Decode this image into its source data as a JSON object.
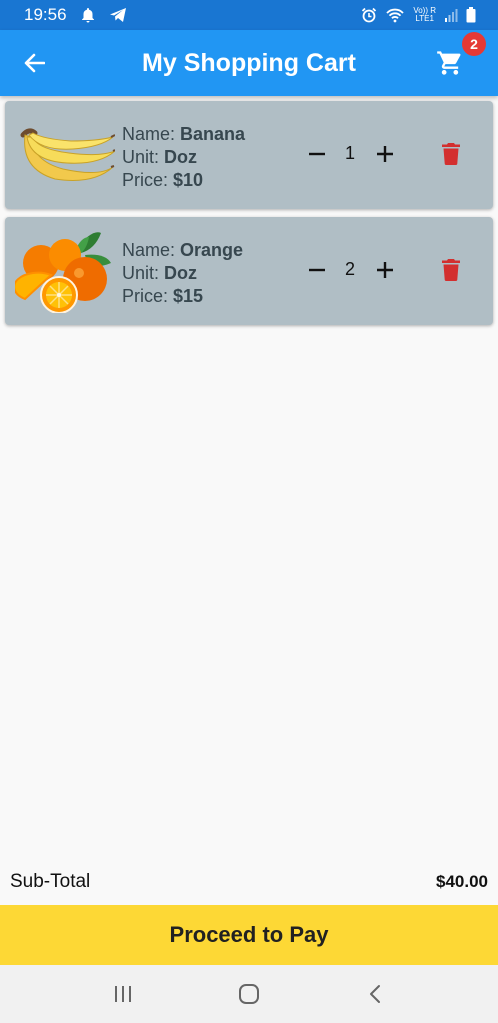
{
  "status_bar": {
    "time": "19:56",
    "network_label": "Vo)) R\nLTE1"
  },
  "app_bar": {
    "title": "My Shopping Cart",
    "cart_count": "2"
  },
  "labels": {
    "name": "Name: ",
    "unit": "Unit: ",
    "price": "Price: "
  },
  "items": [
    {
      "name": "Banana",
      "unit": "Doz",
      "price": "$10",
      "quantity": "1",
      "image_icon": "banana-image"
    },
    {
      "name": "Orange",
      "unit": "Doz",
      "price": "$15",
      "quantity": "2",
      "image_icon": "orange-image"
    }
  ],
  "footer": {
    "subtotal_label": "Sub-Total",
    "subtotal_value": "$40.00",
    "pay_button_label": "Proceed to Pay"
  },
  "colors": {
    "app_bar": "#2196f3",
    "status_bar": "#1976d2",
    "card": "#b0bec5",
    "delete": "#d32f2f",
    "pay_button": "#fdd835",
    "badge": "#e53935"
  }
}
